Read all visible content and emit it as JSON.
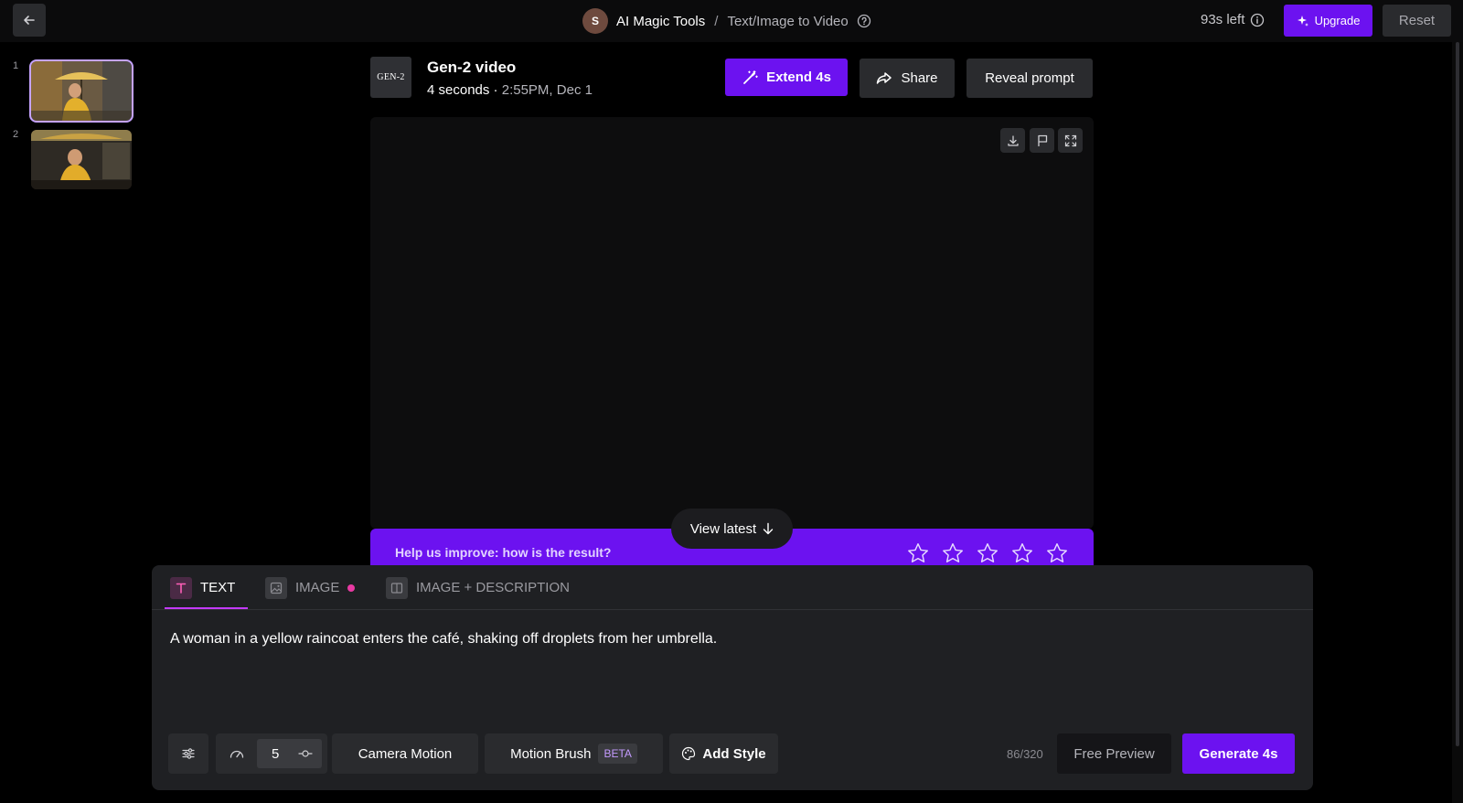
{
  "header": {
    "avatar_initial": "S",
    "breadcrumb_root": "AI Magic Tools",
    "breadcrumb_sep": "/",
    "breadcrumb_current": "Text/Image to Video",
    "time_left": "93s left",
    "upgrade_label": "Upgrade",
    "reset_label": "Reset"
  },
  "history": {
    "items": [
      {
        "number": "1",
        "active": true
      },
      {
        "number": "2",
        "active": false
      }
    ]
  },
  "video": {
    "logo_text": "GEN-2",
    "title": "Gen-2 video",
    "duration": "4 seconds",
    "meta_sep": " · ",
    "timestamp": "2:55PM, Dec 1",
    "extend_label": "Extend 4s",
    "share_label": "Share",
    "reveal_label": "Reveal prompt"
  },
  "feedback": {
    "question": "Help us improve: how is the result?",
    "rating_max": 5,
    "view_latest_label": "View latest"
  },
  "prompt_panel": {
    "tabs": [
      {
        "label": "TEXT",
        "active": true
      },
      {
        "label": "IMAGE",
        "active": false,
        "has_dot": true
      },
      {
        "label": "IMAGE + DESCRIPTION",
        "active": false
      }
    ],
    "prompt_text": "A woman in a yellow raincoat enters the café, shaking off droplets from her umbrella.",
    "speed_value": "5",
    "camera_motion_label": "Camera Motion",
    "motion_brush_label": "Motion Brush",
    "beta_label": "BETA",
    "add_style_label": "Add Style",
    "char_count": "86/320",
    "free_preview_label": "Free Preview",
    "generate_label": "Generate 4s"
  },
  "colors": {
    "accent": "#6c12f0",
    "tab_underline": "#c43bff",
    "dot": "#e93aa3",
    "panel_bg": "#1f2023",
    "button_bg": "#2a2b2e"
  },
  "icons": {
    "back": "arrow-left-icon",
    "help": "question-circle-icon",
    "info": "info-circle-icon",
    "upgrade": "sparkle-icon",
    "extend": "magic-wand-icon",
    "share": "share-arrow-icon",
    "download": "download-icon",
    "flag": "flag-icon",
    "fullscreen": "expand-icon",
    "star": "star-outline-icon",
    "view_latest": "arrow-down-icon",
    "settings": "sliders-icon",
    "speed": "speedometer-icon",
    "stepper": "slider-knob-icon",
    "style": "palette-icon"
  }
}
